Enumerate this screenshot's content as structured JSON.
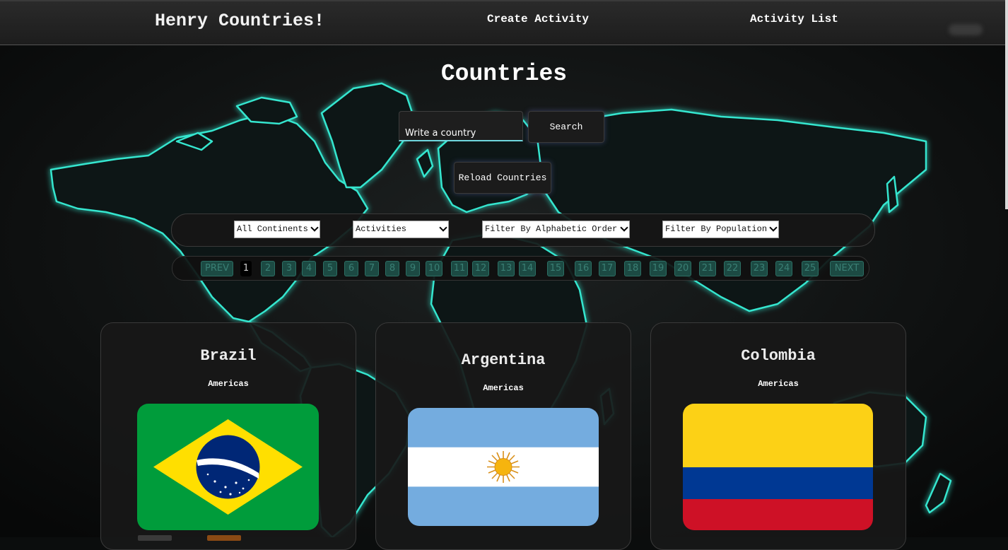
{
  "navbar": {
    "brand": "Henry Countries!",
    "links": [
      "Create Activity",
      "Activity List"
    ]
  },
  "main": {
    "title": "Countries",
    "search": {
      "placeholder": "Write a country",
      "button_label": "Search"
    },
    "reload_label": "Reload Countries"
  },
  "filters": {
    "continent": "All Continents",
    "activities": "Activities",
    "alphabetic": "Filter By Alphabetic Order",
    "population": "Filter By Population"
  },
  "pagination": {
    "prev": "PREV",
    "next": "NEXT",
    "pages": [
      "1",
      "2",
      "3",
      "4",
      "5",
      "6",
      "7",
      "8",
      "9",
      "10",
      "11",
      "12",
      "13",
      "14",
      "15",
      "16",
      "17",
      "18",
      "19",
      "20",
      "21",
      "22",
      "23",
      "24",
      "25"
    ],
    "current": "1"
  },
  "countries": [
    {
      "name": "Brazil",
      "continent": "Americas",
      "flag": "brazil-flag"
    },
    {
      "name": "Argentina",
      "continent": "Americas",
      "flag": "argentina-flag"
    },
    {
      "name": "Colombia",
      "continent": "Americas",
      "flag": "colombia-flag"
    }
  ],
  "colors": {
    "background": "#0b0d0d",
    "map_glow": "#2ee0c8",
    "accent_underline": "#6fd6dd",
    "page_button": "#1c4a43"
  }
}
